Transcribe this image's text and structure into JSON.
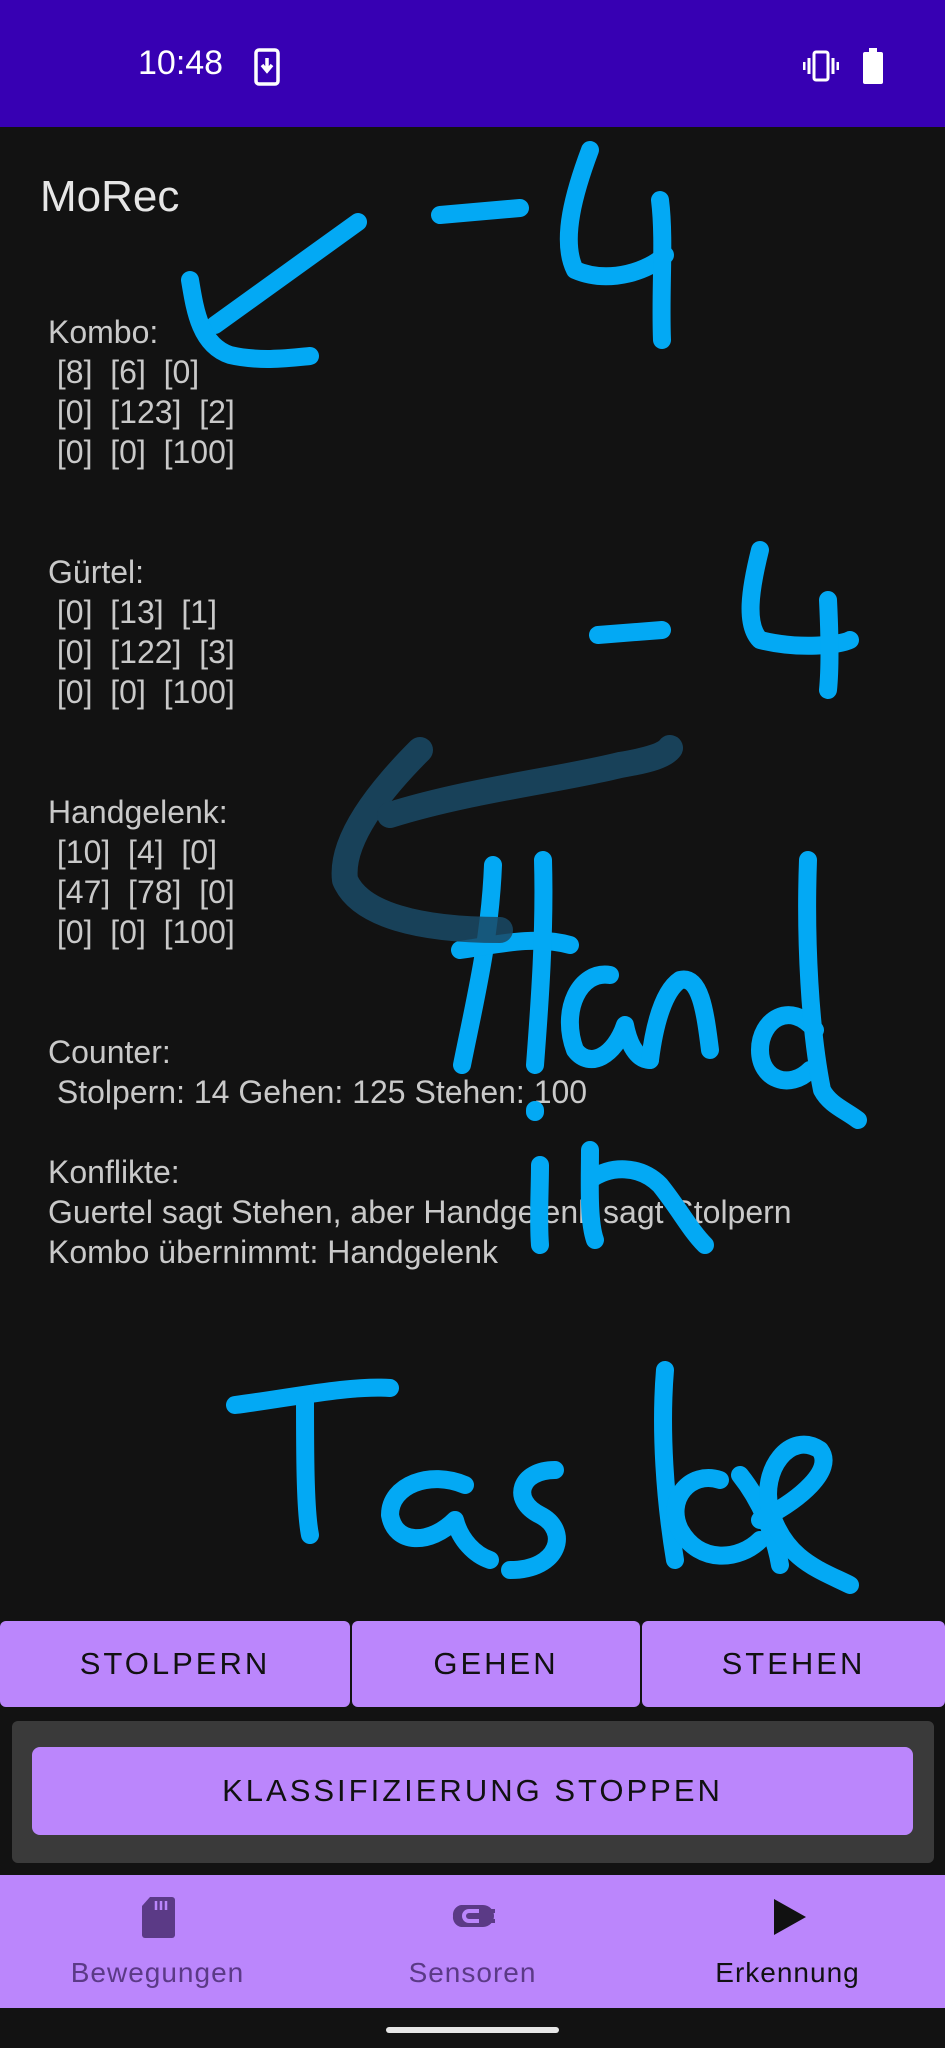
{
  "status_bar": {
    "time": "10:48",
    "icons": [
      "download-phone-icon",
      "vibrate-icon",
      "battery-icon"
    ]
  },
  "app": {
    "title": "MoRec"
  },
  "sections": {
    "kombo": {
      "label": "Kombo:",
      "rows": [
        " [8]  [6]  [0]",
        " [0]  [123]  [2]",
        " [0]  [0]  [100]"
      ]
    },
    "guertel": {
      "label": "Gürtel:",
      "rows": [
        " [0]  [13]  [1]",
        " [0]  [122]  [3]",
        " [0]  [0]  [100]"
      ]
    },
    "handgelenk": {
      "label": "Handgelenk:",
      "rows": [
        " [10]  [4]  [0]",
        " [47]  [78]  [0]",
        " [0]  [0]  [100]"
      ]
    },
    "counter": {
      "label": "Counter:",
      "text": " Stolpern: 14 Gehen: 125 Stehen: 100"
    },
    "konflikte": {
      "label": "Konflikte:",
      "lines": [
        "Guertel sagt Stehen, aber Handgelenk sagt Stolpern",
        "Kombo übernimmt: Handgelenk"
      ]
    }
  },
  "annotation": {
    "color": "#03a9f4",
    "handwriting": [
      "-4",
      "-4",
      "Hand in Tasche"
    ]
  },
  "class_buttons": {
    "stolpern": "STOLPERN",
    "gehen": "GEHEN",
    "stehen": "STEHEN"
  },
  "stop_button": "KLASSIFIZIERUNG STOPPEN",
  "bottom_nav": {
    "items": [
      {
        "label": "Bewegungen",
        "icon": "sd-card-icon",
        "active": false
      },
      {
        "label": "Sensoren",
        "icon": "sensor-plug-icon",
        "active": false
      },
      {
        "label": "Erkennung",
        "icon": "play-icon",
        "active": true
      }
    ]
  },
  "colors": {
    "status_bar": "#3700b3",
    "background": "#121212",
    "accent": "#bb86fc",
    "text": "#c9c9c9"
  }
}
